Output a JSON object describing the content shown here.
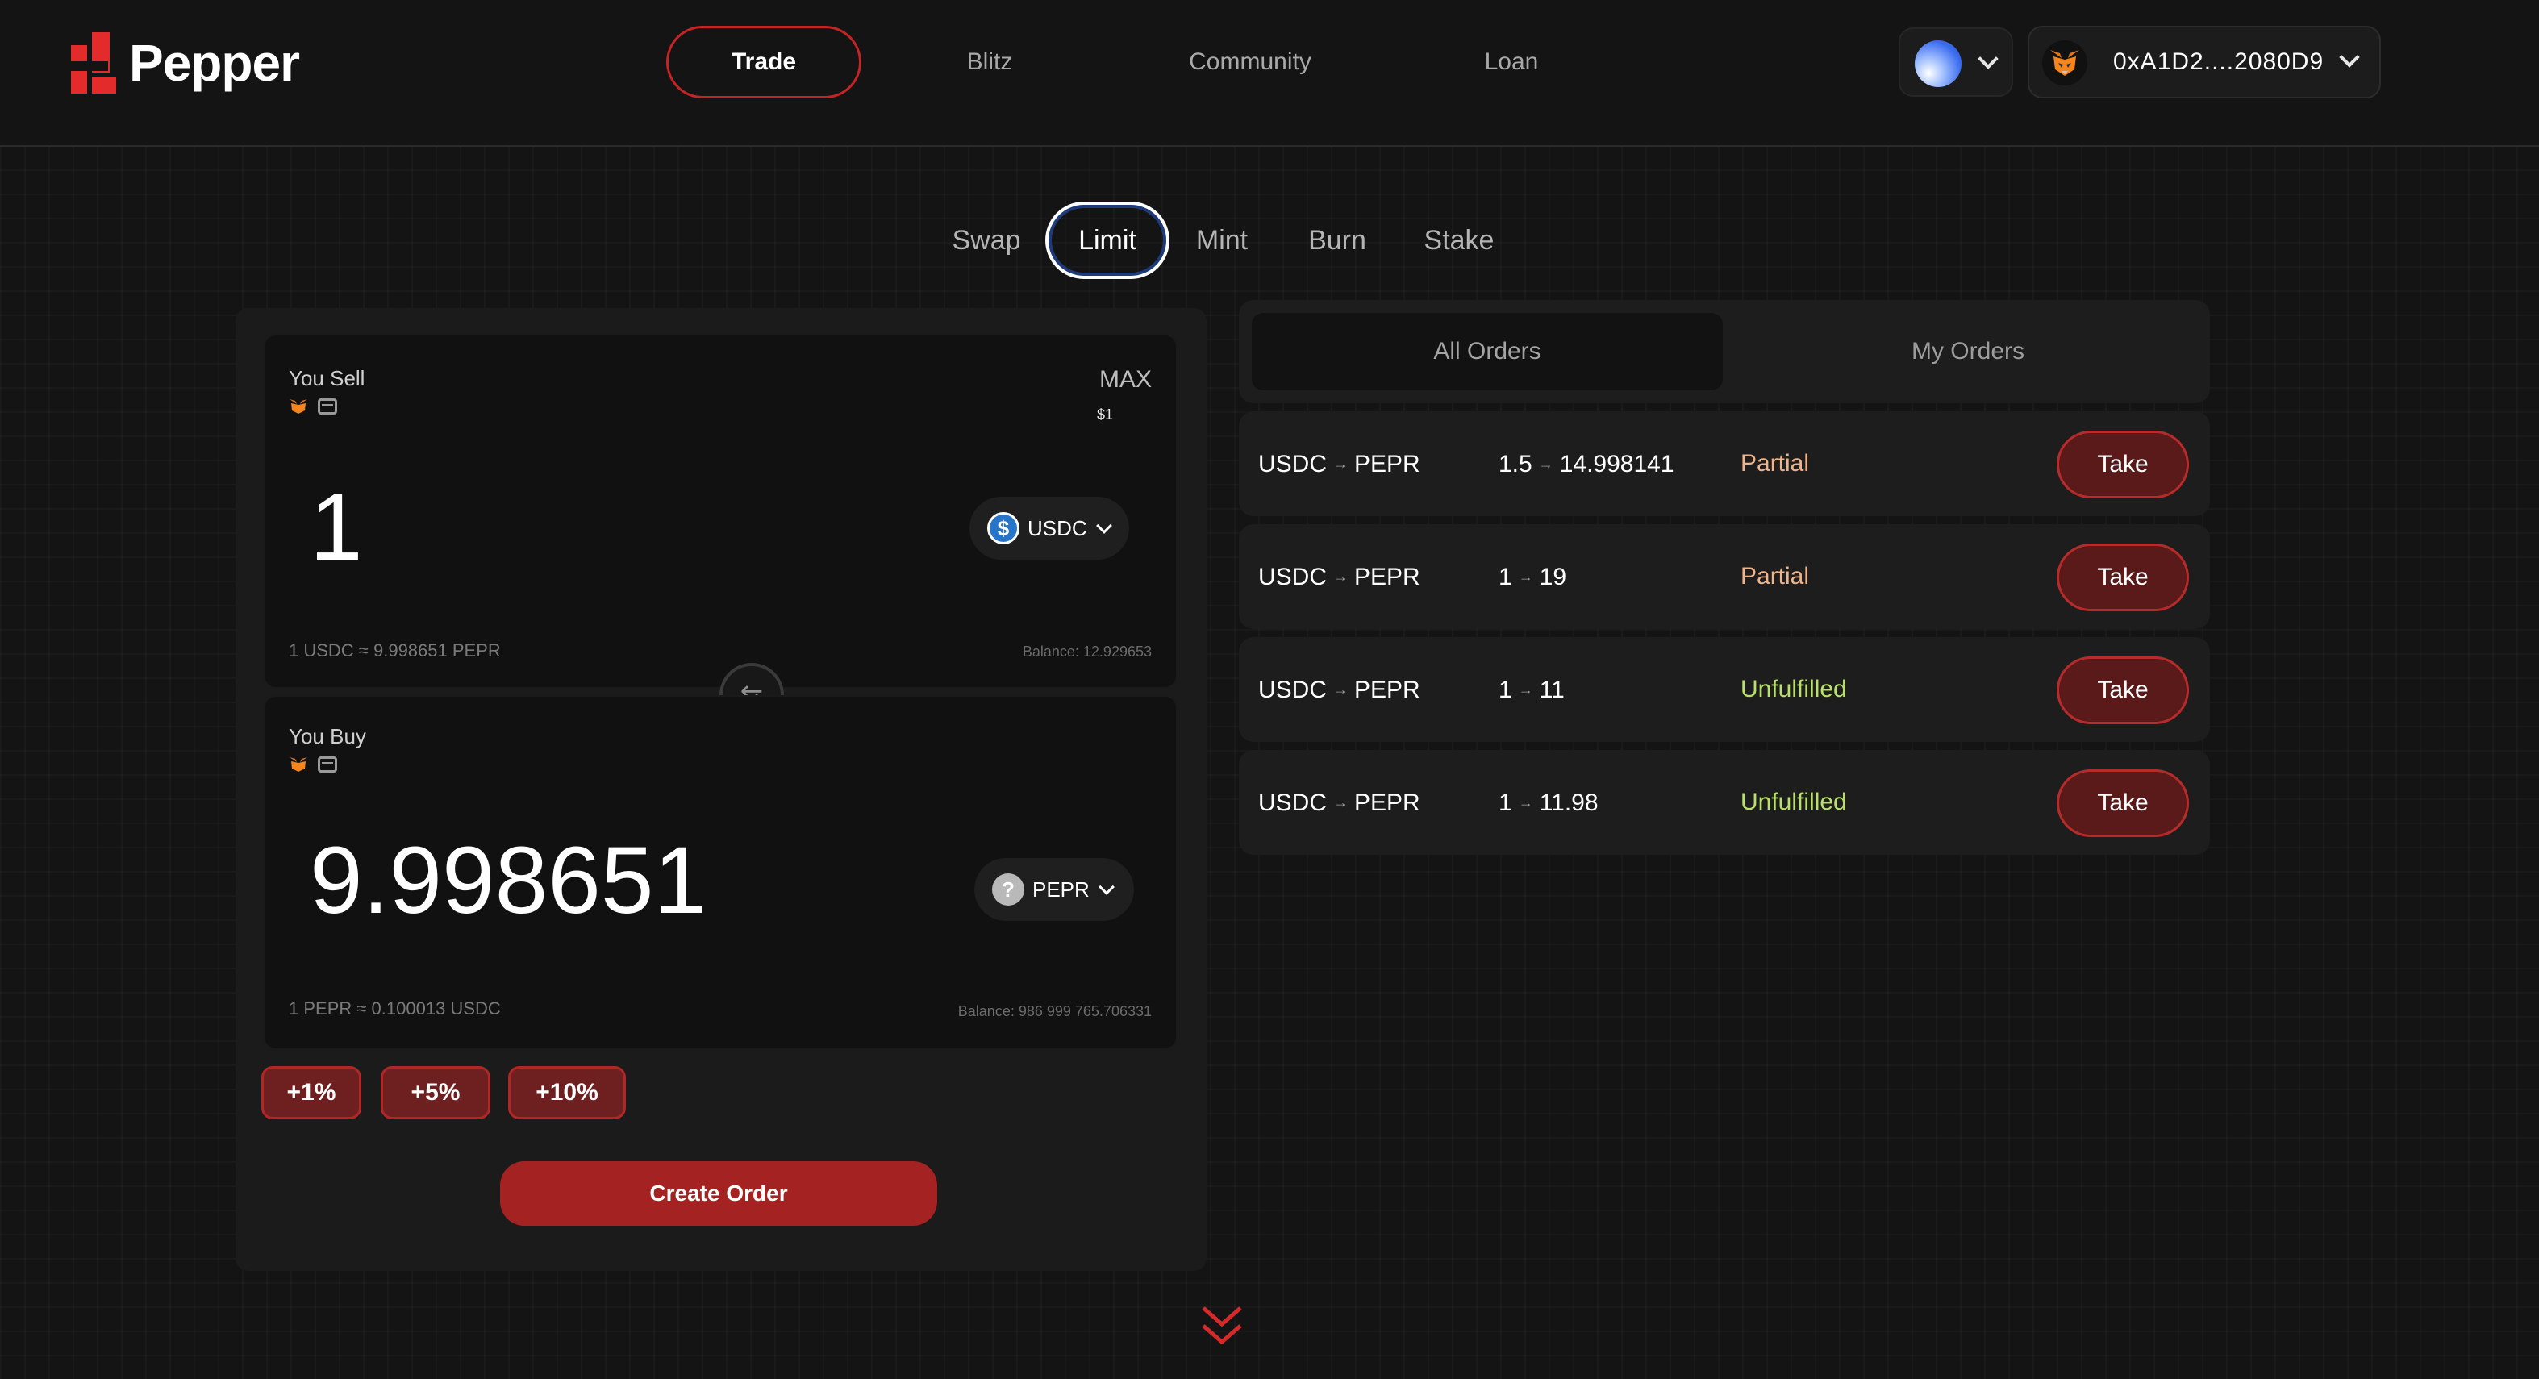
{
  "brand": {
    "name": "Pepper",
    "accent": "#e32b2b"
  },
  "nav": {
    "items": [
      {
        "label": "Trade",
        "active": true
      },
      {
        "label": "Blitz",
        "active": false
      },
      {
        "label": "Community",
        "active": false
      },
      {
        "label": "Loan",
        "active": false
      }
    ]
  },
  "wallet": {
    "address": "0xA1D2....2080D9",
    "network_icon": "globe-network-icon",
    "wallet_icon": "metamask-fox-icon"
  },
  "subtabs": [
    {
      "label": "Swap",
      "active": false
    },
    {
      "label": "Limit",
      "active": true
    },
    {
      "label": "Mint",
      "active": false
    },
    {
      "label": "Burn",
      "active": false
    },
    {
      "label": "Stake",
      "active": false
    }
  ],
  "sell": {
    "label": "You Sell",
    "max_label": "MAX",
    "max_value": "$1",
    "amount": "1",
    "token": "USDC",
    "rate": "1 USDC ≈ 9.998651 PEPR",
    "balance": "Balance: 12.929653"
  },
  "buy": {
    "label": "You Buy",
    "amount": "9.998651",
    "token": "PEPR",
    "rate": "1 PEPR ≈ 0.100013 USDC",
    "balance": "Balance: 986 999 765.706331"
  },
  "swap_icon": "⇆",
  "percent_buttons": [
    "+1%",
    "+5%",
    "+10%"
  ],
  "create_order_label": "Create Order",
  "orders": {
    "tabs": [
      {
        "label": "All Orders",
        "active": true
      },
      {
        "label": "My Orders",
        "active": false
      }
    ],
    "rows": [
      {
        "from": "USDC",
        "to": "PEPR",
        "rate_from": "1.5",
        "rate_to": "14.998141",
        "status": "Partial",
        "action": "Take"
      },
      {
        "from": "USDC",
        "to": "PEPR",
        "rate_from": "1",
        "rate_to": "19",
        "status": "Partial",
        "action": "Take"
      },
      {
        "from": "USDC",
        "to": "PEPR",
        "rate_from": "1",
        "rate_to": "11",
        "status": "Unfulfilled",
        "action": "Take"
      },
      {
        "from": "USDC",
        "to": "PEPR",
        "rate_from": "1",
        "rate_to": "11.98",
        "status": "Unfulfilled",
        "action": "Take"
      }
    ],
    "arrow_glyph": "→"
  },
  "colors": {
    "partial": "#f0b38a",
    "unfulfilled": "#b8e06a",
    "button_red": "#a52222"
  }
}
